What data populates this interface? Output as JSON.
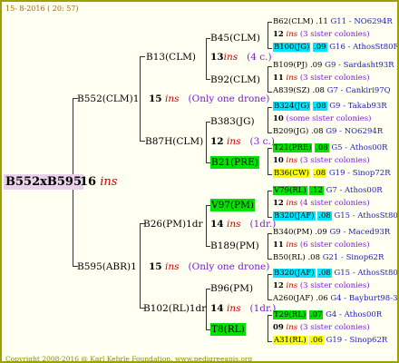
{
  "header": "15- 8-2016 ( 20: 57)",
  "footer": "Copyright 2008-2016 @ Karl Kehrle Foundation.   www.pedigreeapis.org",
  "root": {
    "name": "B552xB595",
    "ins": "16",
    "ins_word": "ins"
  },
  "level1": [
    {
      "name": "B552(CLM)1",
      "ins": "15",
      "ins_word": "ins",
      "note": "(Only one drone)"
    },
    {
      "name": "B595(ABR)1",
      "ins": "15",
      "ins_word": "ins",
      "note": "(Only one drone)"
    }
  ],
  "level2": [
    {
      "name": "B13(CLM)",
      "ins": "13",
      "ins_word": "ins",
      "note": "(4 c.)"
    },
    {
      "name": "B87H(CLM)",
      "ins": "12",
      "ins_word": "ins",
      "note": "(3 c.)"
    },
    {
      "name": "B26(PM)1dr",
      "ins": "14",
      "ins_word": "ins",
      "note": "(1dr.)"
    },
    {
      "name": "B102(RL)1dr",
      "ins": "14",
      "ins_word": "ins",
      "note": "(1dr.)"
    }
  ],
  "level3": [
    {
      "name": "B45(CLM)",
      "ins": "13",
      "ins_word": "ins",
      "note": "(4 c.)"
    },
    {
      "name": "B92(CLM)",
      "ins": "",
      "ins_word": "",
      "note": ""
    },
    {
      "name": "B383(JG)",
      "ins": "",
      "ins_word": "",
      "note": ""
    },
    {
      "name": "B21(PRE)",
      "ins": "",
      "ins_word": "",
      "note": ""
    },
    {
      "name": "V97(PM)",
      "ins": "",
      "ins_word": "",
      "note": ""
    },
    {
      "name": "B189(PM)",
      "ins": "",
      "ins_word": "",
      "note": ""
    },
    {
      "name": "B96(PM)",
      "ins": "",
      "ins_word": "",
      "note": ""
    },
    {
      "name": "T8(RL)",
      "ins": "",
      "ins_word": "",
      "note": ""
    }
  ],
  "level4": [
    {
      "line1": {
        "name": "B62(CLM)",
        "stat": ".11",
        "src": "G11 - NO6294R"
      },
      "ins": "12",
      "ins_word": "ins",
      "note": "(3 sister colonies)",
      "line2": {
        "name": "B100(JG)",
        "stat": ".09",
        "src": "G16 - AthosSt80R",
        "hl": "cyan"
      }
    },
    {
      "line1": {
        "name": "B109(PJ)",
        "stat": ".09",
        "src": "G9 - Sardasht93R"
      },
      "ins": "11",
      "ins_word": "ins",
      "note": "(3 sister colonies)",
      "line2": {
        "name": "A839(SZ)",
        "stat": ".08",
        "src": "G7 - Cankiri97Q"
      }
    },
    {
      "line1": {
        "name": "B324(JG)",
        "stat": ".08",
        "src": "G9 - Takab93R",
        "hl": "cyan"
      },
      "ins": "10",
      "ins_word": "",
      "note": "(some sister colonies)",
      "line2": {
        "name": "B209(JG)",
        "stat": ".08",
        "src": "G9 - NO6294R"
      }
    },
    {
      "line1": {
        "name": "T21(PRE)",
        "stat": ".08",
        "src": "G5 - Athos00R",
        "hl": "green"
      },
      "ins": "10",
      "ins_word": "ins",
      "note": "(3 sister colonies)",
      "line2": {
        "name": "B36(CW)",
        "stat": ".08",
        "src": "G19 - Sinop72R",
        "hl": "yellow"
      }
    },
    {
      "line1": {
        "name": "V79(RL)",
        "stat": ".12",
        "src": "G7 - Athos00R",
        "hl": "green"
      },
      "ins": "12",
      "ins_word": "ins",
      "note": "(4 sister colonies)",
      "line2": {
        "name": "B320(JAF)",
        "stat": ".08",
        "src": "G15 - AthosSt80R",
        "hl": "cyan"
      }
    },
    {
      "line1": {
        "name": "B340(PM)",
        "stat": ".09",
        "src": "G9 - Maced93R"
      },
      "ins": "11",
      "ins_word": "ins",
      "note": "(6 sister colonies)",
      "line2": {
        "name": "B50(RL)",
        "stat": ".08",
        "src": "G21 - Sinop62R"
      }
    },
    {
      "line1": {
        "name": "B320(JAF)",
        "stat": ".08",
        "src": "G15 - AthosSt80R",
        "hl": "cyan"
      },
      "ins": "12",
      "ins_word": "ins",
      "note": "(3 sister colonies)",
      "line2": {
        "name": "A260(JAF)",
        "stat": ".06",
        "src": "G4 - Bayburt98-3"
      }
    },
    {
      "line1": {
        "name": "T29(RL)",
        "stat": ".07",
        "src": "G4 - Athos00R",
        "hl": "green"
      },
      "ins": "09",
      "ins_word": "ins",
      "note": "(3 sister colonies)",
      "line2": {
        "name": "A31(RL)",
        "stat": ".06",
        "src": "G19 - Sinop62R",
        "hl": "yellow"
      }
    }
  ],
  "colors": {
    "ins": "#d00000",
    "note": "#7a1bd9",
    "src": "#2020b0",
    "cyan": "#00e5ff",
    "green": "#00e200",
    "yellow": "#ffff00",
    "root_bg": "#e9d1e9",
    "border": "#9fa000"
  }
}
